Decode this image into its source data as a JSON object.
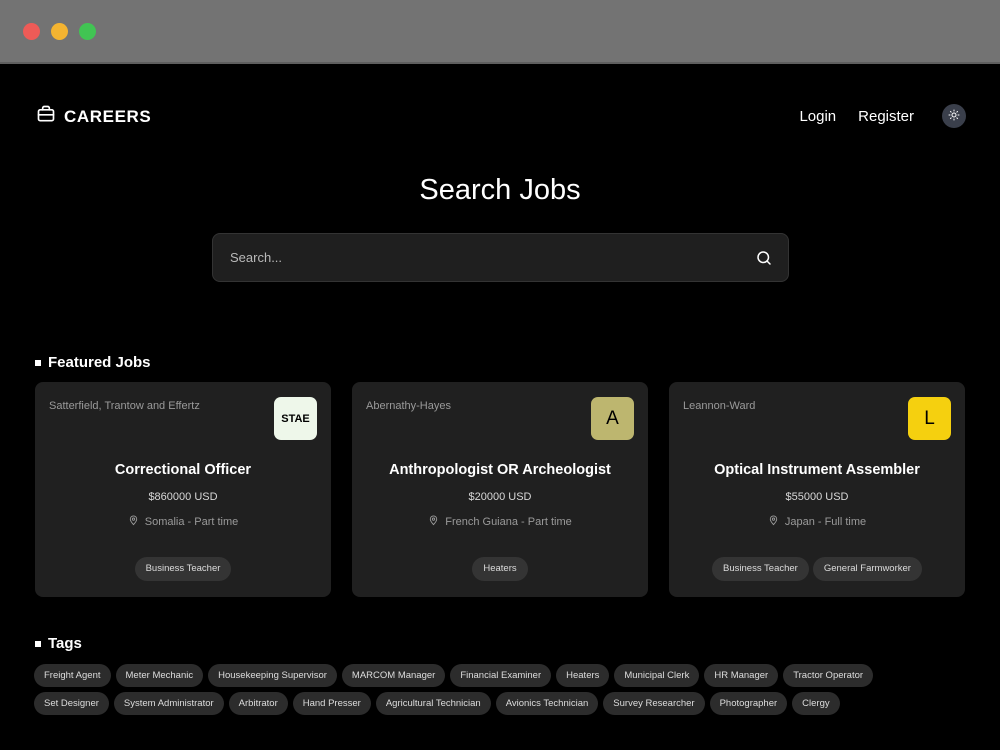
{
  "brand": {
    "name": "CAREERS",
    "icon": "briefcase-icon"
  },
  "nav": {
    "login": "Login",
    "register": "Register",
    "theme_icon": "sun-icon"
  },
  "hero": {
    "title": "Search Jobs"
  },
  "search": {
    "placeholder": "Search...",
    "icon": "search-icon"
  },
  "featured": {
    "title": "Featured Jobs",
    "jobs": [
      {
        "company": "Satterfield, Trantow and Effertz",
        "logo_text": "STAE",
        "logo_color": "#eef7ea",
        "title": "Correctional Officer",
        "salary": "$860000 USD",
        "location": "Somalia - Part time",
        "tags": [
          "Business Teacher"
        ]
      },
      {
        "company": "Abernathy-Hayes",
        "logo_text": "A",
        "logo_color": "#bdb66f",
        "title": "Anthropologist OR Archeologist",
        "salary": "$20000 USD",
        "location": "French Guiana - Part time",
        "tags": [
          "Heaters"
        ]
      },
      {
        "company": "Leannon-Ward",
        "logo_text": "L",
        "logo_color": "#f5d00f",
        "title": "Optical Instrument Assembler",
        "salary": "$55000 USD",
        "location": "Japan - Full time",
        "tags": [
          "Business Teacher",
          "General Farmworker"
        ]
      }
    ]
  },
  "tags_section": {
    "title": "Tags",
    "rows": [
      [
        "Freight Agent",
        "Meter Mechanic",
        "Housekeeping Supervisor",
        "MARCOM Manager",
        "Financial Examiner",
        "Heaters",
        "Municipal Clerk",
        "HR Manager",
        "Tractor Operator"
      ],
      [
        "Set Designer",
        "System Administrator",
        "Arbitrator",
        "Hand Presser",
        "Agricultural Technician",
        "Avionics Technician",
        "Survey Researcher",
        "Photographer",
        "Clergy"
      ]
    ]
  }
}
